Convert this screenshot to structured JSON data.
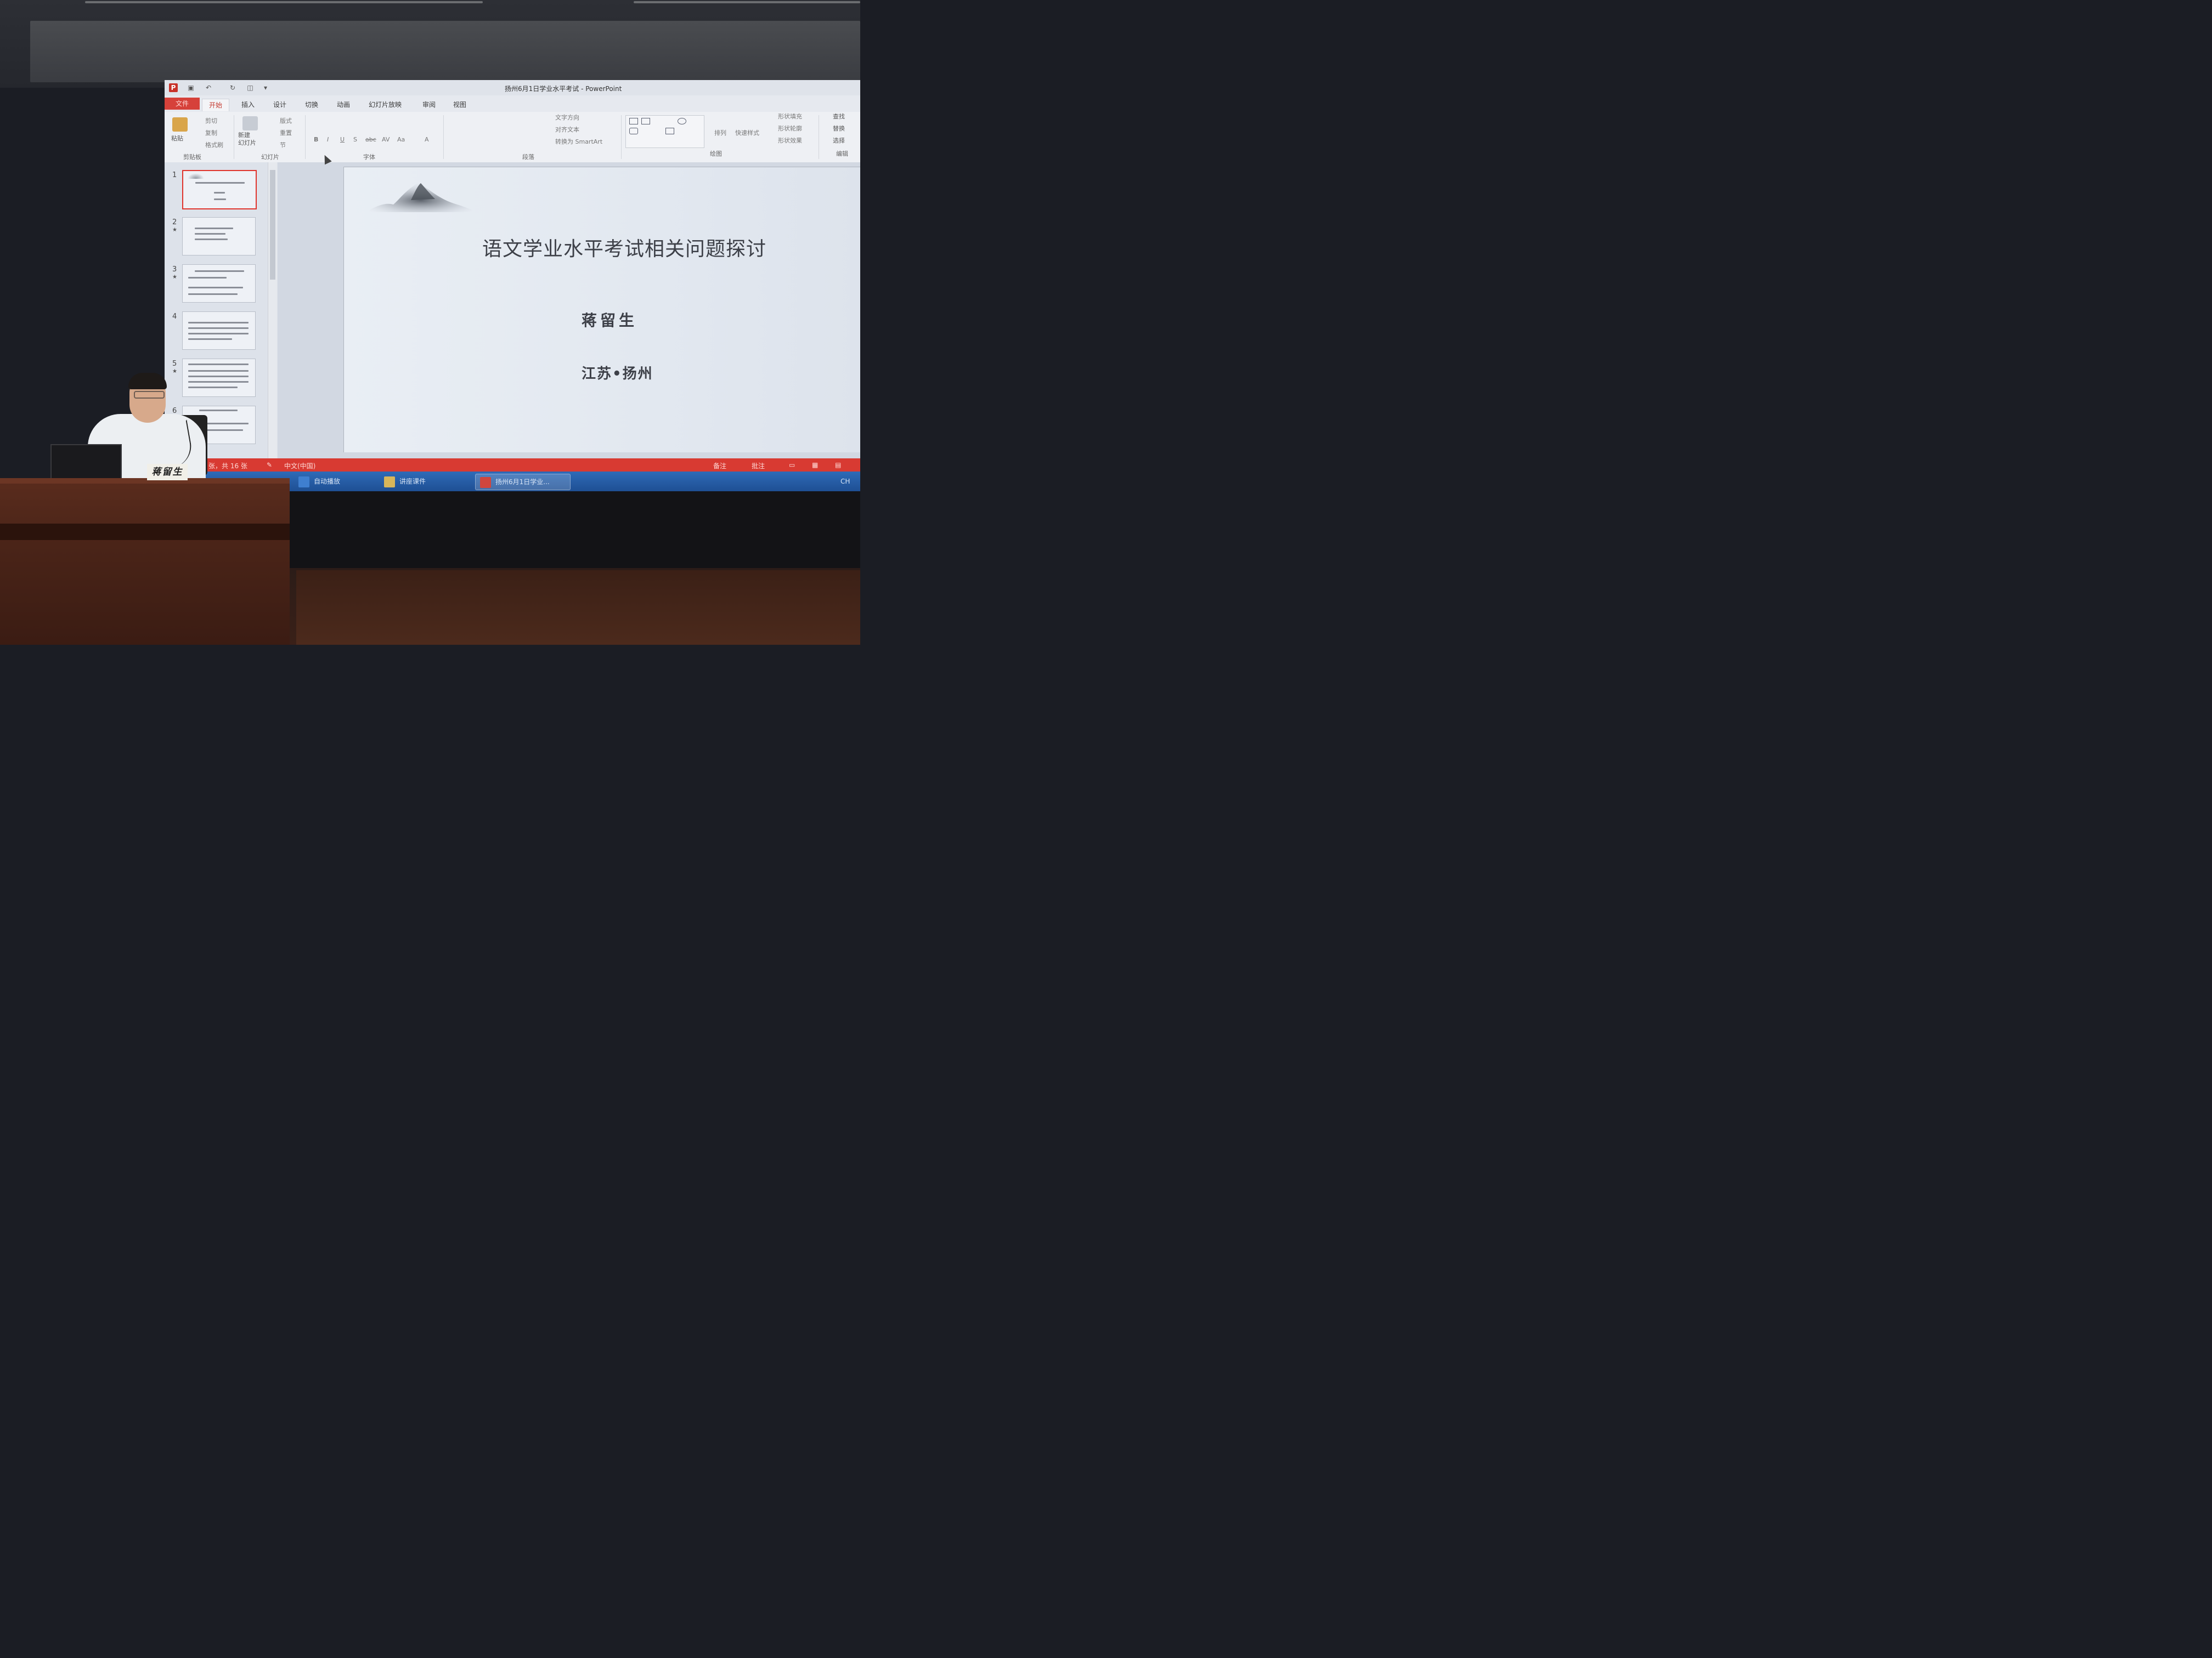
{
  "window": {
    "title": "扬州6月1日学业水平考试 - PowerPoint",
    "app_icon": "P"
  },
  "ribbon_tabs": [
    "文件",
    "开始",
    "插入",
    "设计",
    "切换",
    "动画",
    "幻灯片放映",
    "审阅",
    "视图"
  ],
  "ribbon": {
    "clipboard": {
      "paste": "粘贴",
      "cut": "剪切",
      "copy": "复制",
      "format_painter": "格式刷",
      "group": "剪贴板"
    },
    "slides": {
      "new_slide": "新建\n幻灯片",
      "layout": "版式",
      "reset": "重置",
      "section": "节",
      "group": "幻灯片"
    },
    "font": {
      "group": "字体",
      "bold": "B",
      "italic": "I",
      "underline": "U",
      "shadow": "S",
      "strike": "abc",
      "spacing": "AV",
      "case": "Aa",
      "color": "A"
    },
    "paragraph": {
      "group": "段落",
      "text_direction": "文字方向",
      "align_text": "对齐文本",
      "smartart": "转换为 SmartArt"
    },
    "drawing": {
      "group": "绘图",
      "arrange": "排列",
      "quick_styles": "快速样式",
      "shape_fill": "形状填充",
      "shape_outline": "形状轮廓",
      "shape_effects": "形状效果"
    },
    "editing": {
      "group": "编辑",
      "find": "查找",
      "replace": "替换",
      "select": "选择"
    }
  },
  "thumbnails": [
    {
      "num": "1",
      "star": ""
    },
    {
      "num": "2",
      "star": "★"
    },
    {
      "num": "3",
      "star": "★"
    },
    {
      "num": "4",
      "star": ""
    },
    {
      "num": "5",
      "star": "★"
    },
    {
      "num": "6",
      "star": ""
    }
  ],
  "slide": {
    "title": "语文学业水平考试相关问题探讨",
    "author": "蒋留生",
    "place": "江苏•扬州"
  },
  "statusbar": {
    "slide_count": "张，共 16 张",
    "language": "中文(中国)",
    "notes": "备注",
    "comments": "批注"
  },
  "taskbar": {
    "items": [
      "自动播放",
      "讲座课件",
      "扬州6月1日学业..."
    ],
    "tray": "CH"
  },
  "nameplate": "蒋留生"
}
